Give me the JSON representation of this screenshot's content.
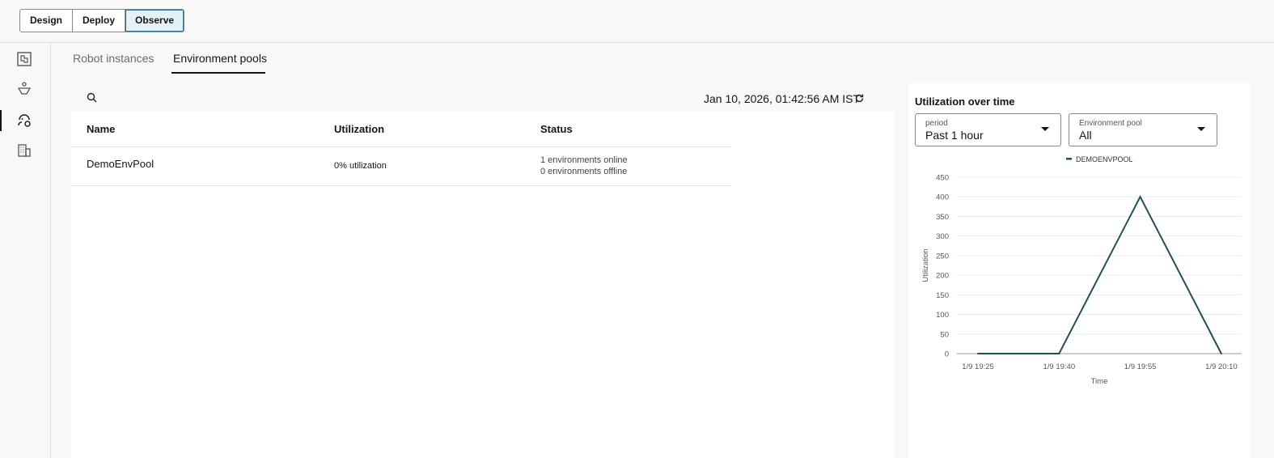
{
  "topnav": {
    "items": [
      {
        "label": "Design"
      },
      {
        "label": "Deploy"
      },
      {
        "label": "Observe",
        "active": true
      }
    ]
  },
  "sidebar": {
    "icons": [
      "puzzle-icon",
      "robot-deploy-icon",
      "robot-observe-icon",
      "building-icon"
    ]
  },
  "tabs": [
    {
      "label": "Robot instances"
    },
    {
      "label": "Environment pools",
      "active": true
    }
  ],
  "toolbar": {
    "timestamp": "Jan 10, 2026, 01:42:56 AM IST"
  },
  "table": {
    "headers": [
      "Name",
      "Utilization",
      "Status"
    ],
    "rows": [
      {
        "name": "DemoEnvPool",
        "utilization": "0% utilization",
        "status_online": "1 environments online",
        "status_offline": "0 environments offline"
      }
    ]
  },
  "panel": {
    "title": "Utilization over time",
    "period": {
      "label": "period",
      "value": "Past 1 hour"
    },
    "pool": {
      "label": "Environment pool",
      "value": "All"
    }
  },
  "chart_data": {
    "type": "line",
    "legend": "DEMOENVPOOL",
    "xlabel": "Time",
    "ylabel": "Utilization",
    "x": [
      "1/9 19:25",
      "1/9 19:40",
      "1/9 19:55",
      "1/9 20:10"
    ],
    "series": [
      {
        "name": "DEMOENVPOOL",
        "values": [
          0,
          0,
          400,
          0
        ],
        "color": "#1f5156"
      }
    ],
    "yticks": [
      0,
      50,
      100,
      150,
      200,
      250,
      300,
      350,
      400,
      450
    ],
    "ylim": [
      0,
      450
    ],
    "grid": true,
    "legend_position": "top-center"
  }
}
